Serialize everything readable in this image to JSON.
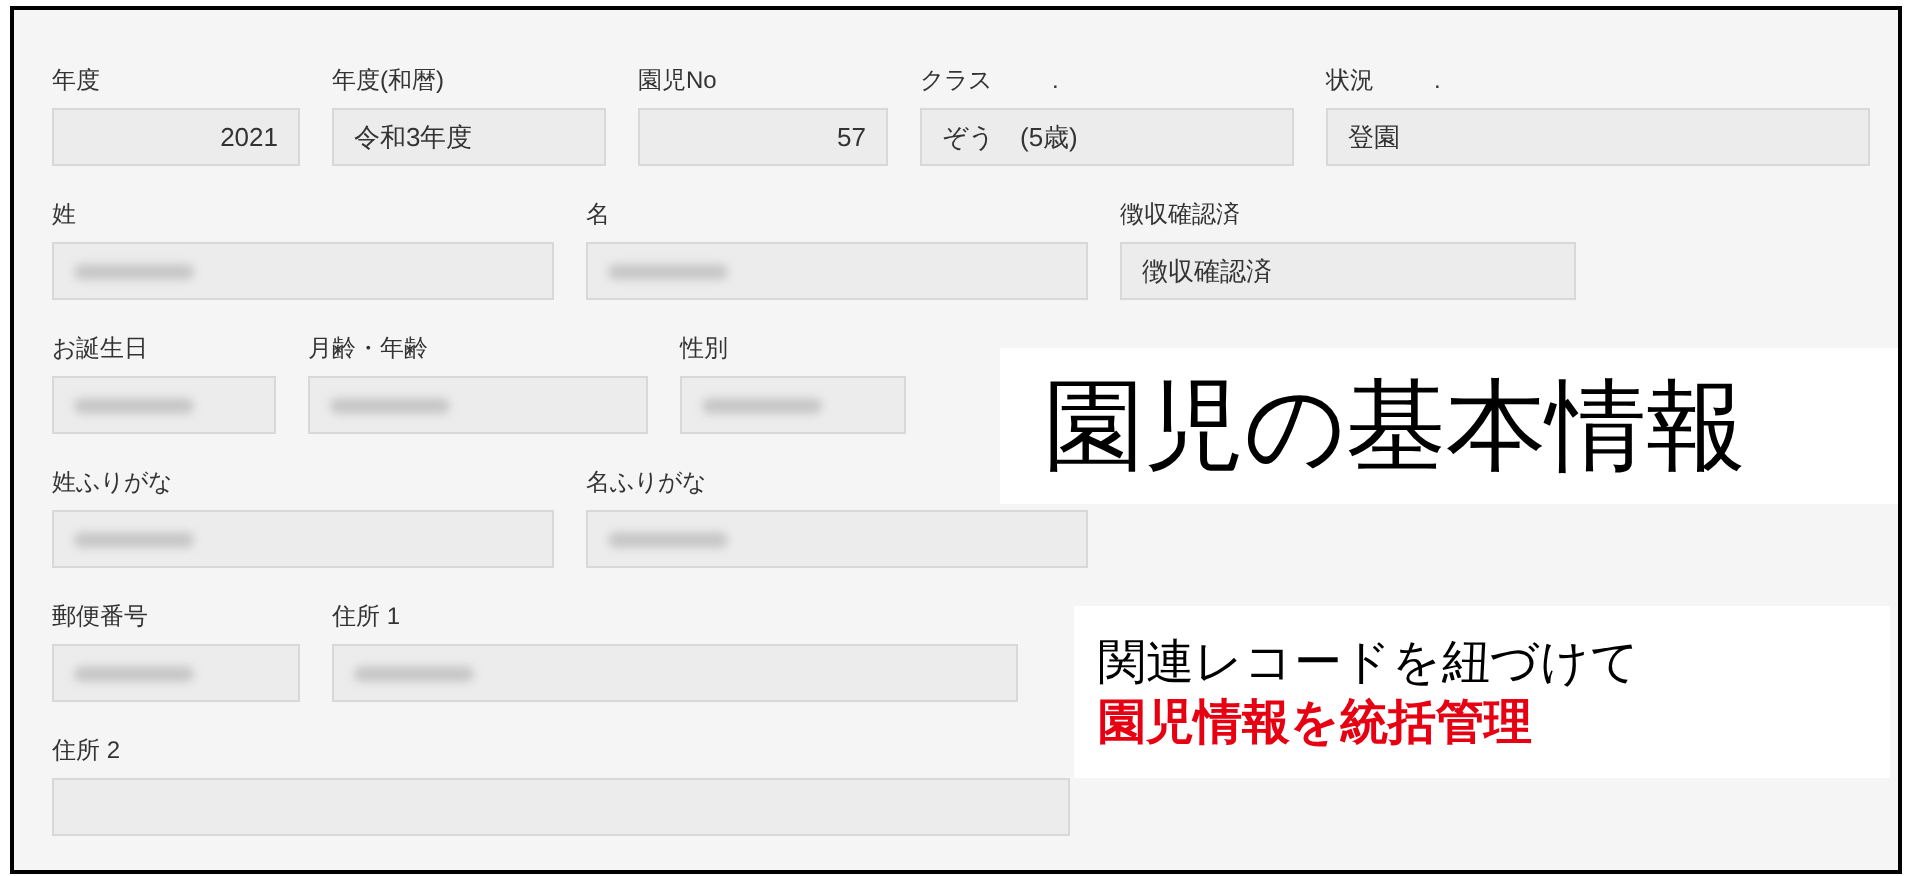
{
  "form_rows": [
    [
      {
        "label": "年度",
        "value": "2021",
        "kind": "numeric"
      },
      {
        "label": "年度(和暦)",
        "value": "令和3年度",
        "kind": "text"
      },
      {
        "label": "園児No",
        "value": "57",
        "kind": "numeric"
      },
      {
        "label": "クラス",
        "label_mark": ".",
        "value": "ぞう　(5歳)",
        "kind": "text"
      },
      {
        "label": "状況",
        "label_mark": ".",
        "value": "登園",
        "kind": "text"
      }
    ],
    [
      {
        "label": "姓",
        "redacted": true
      },
      {
        "label": "名",
        "redacted": true
      },
      {
        "label": "徴収確認済",
        "value": "徴収確認済",
        "kind": "text"
      }
    ],
    [
      {
        "label": "お誕生日",
        "redacted": true
      },
      {
        "label": "月齢・年齢",
        "redacted": true
      },
      {
        "label": "性別",
        "redacted": true
      }
    ],
    [
      {
        "label": "姓ふりがな",
        "redacted": true
      },
      {
        "label": "名ふりがな",
        "redacted": true
      }
    ],
    [
      {
        "label": "郵便番号",
        "redacted": true
      },
      {
        "label": "住所 1",
        "redacted": true
      }
    ],
    [
      {
        "label": "住所 2"
      }
    ]
  ],
  "headline": "園児の基本情報",
  "callout": {
    "line_1": "関連レコードを紐づけて",
    "line_2": "園児情報を統括管理"
  }
}
